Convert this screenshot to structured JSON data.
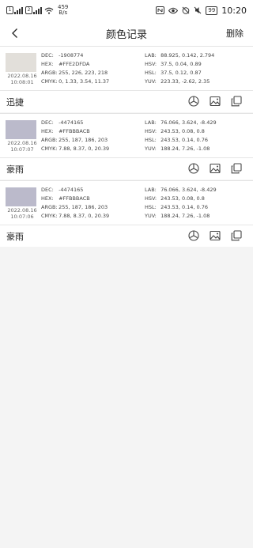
{
  "status_bar": {
    "sim1": "4G",
    "sim2": "4G",
    "speed_value": "459",
    "speed_unit": "B/s",
    "battery": "99",
    "time": "10:20"
  },
  "nav": {
    "title": "颜色记录",
    "delete_label": "删除"
  },
  "records": [
    {
      "swatch_color": "#e2dfda",
      "date": "2022.08.16",
      "time": "10:08:01",
      "dec": "-1908774",
      "hex": "#FFE2DFDA",
      "argb": "255, 226, 223, 218",
      "cmyk": "0, 1.33, 3.54, 11.37",
      "lab": "88.925, 0.142, 2.794",
      "hsv": "37.5, 0.04, 0.89",
      "hsl": "37.5, 0.12, 0.87",
      "yuv": "223.33, -2.62, 2.35",
      "name": "迅捷"
    },
    {
      "swatch_color": "#bbbacb",
      "date": "2022.08.16",
      "time": "10:07:07",
      "dec": "-4474165",
      "hex": "#FFBBBACB",
      "argb": "255, 187, 186, 203",
      "cmyk": "7.88, 8.37, 0, 20.39",
      "lab": "76.066, 3.624, -8.429",
      "hsv": "243.53, 0.08, 0.8",
      "hsl": "243.53, 0.14, 0.76",
      "yuv": "188.24, 7.26, -1.08",
      "name": "豪雨"
    },
    {
      "swatch_color": "#bbbacb",
      "date": "2022.08.16",
      "time": "10:07:06",
      "dec": "-4474165",
      "hex": "#FFBBBACB",
      "argb": "255, 187, 186, 203",
      "cmyk": "7.88, 8.37, 0, 20.39",
      "lab": "76.066, 3.624, -8.429",
      "hsv": "243.53, 0.08, 0.8",
      "hsl": "243.53, 0.14, 0.76",
      "yuv": "188.24, 7.26, -1.08",
      "name": "豪雨"
    }
  ],
  "labels": {
    "dec": "DEC:",
    "hex": "HEX:",
    "argb": "ARGB:",
    "cmyk": "CMYK:",
    "lab": "LAB:",
    "hsv": "HSV:",
    "hsl": "HSL:",
    "yuv": "YUV:"
  },
  "icons": {
    "status_left": [
      "sim-card-icon",
      "signal-icon",
      "wifi-icon"
    ],
    "status_right": [
      "nfc-icon",
      "eye-icon",
      "alarm-off-icon",
      "mute-icon",
      "battery-icon"
    ],
    "back": "back-arrow-icon",
    "actions": [
      "palette-icon",
      "image-icon",
      "copy-icon"
    ]
  }
}
